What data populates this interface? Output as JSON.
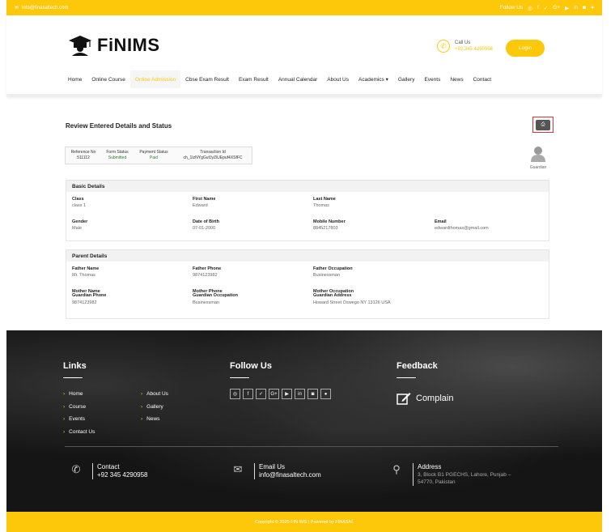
{
  "topbar": {
    "email": "info@finasaltech.com",
    "follow_label": "Follow Us",
    "social_icons": [
      "whatsapp-icon",
      "facebook-icon",
      "twitter-icon",
      "google-plus-icon",
      "youtube-icon",
      "linkedin-icon",
      "instagram-icon",
      "dribbble-icon"
    ]
  },
  "header": {
    "brand": "FiNIMS",
    "call_label": "Call Us",
    "call_number": "+92 345 4290958",
    "login_label": "Login"
  },
  "nav": {
    "items": [
      "Home",
      "Online Course",
      "Online Admission",
      "Cbse Exam Result",
      "Exam Result",
      "Annual Calendar",
      "About Us",
      "Academics ▾",
      "Gallery",
      "Events",
      "News",
      "Contact"
    ],
    "active": "Online Admission"
  },
  "review": {
    "title": "Review Entered Details and Status",
    "status": {
      "reference_label": "Reference No",
      "reference_value": "511112",
      "form_label": "Form Status",
      "form_value": "Submitted",
      "payment_label": "Payment Status",
      "payment_value": "Paid",
      "txn_label": "Transaction Id",
      "txn_value": "ch_1IzNYgGufJyZiUEpuf4XSfFC"
    },
    "guardian_label": "Guardian"
  },
  "basic": {
    "title": "Basic Details",
    "class_k": "Class",
    "class_v": "class 1",
    "first_k": "First Name",
    "first_v": "Edward",
    "last_k": "Last Name",
    "last_v": "Thomas",
    "gender_k": "Gender",
    "gender_v": "Male",
    "dob_k": "Date of Birth",
    "dob_v": "07-01-2000",
    "mobile_k": "Mobile Number",
    "mobile_v": "8845217803",
    "email_k": "Email",
    "email_v": "edwardthomas@gmail.com"
  },
  "parent": {
    "title": "Parent Details",
    "fname_k": "Father Name",
    "fname_v": "Mr. Thomas",
    "fphone_k": "Father Phone",
    "fphone_v": "9874123982",
    "focc_k": "Father Occupation",
    "focc_v": "Businessman",
    "mname_k": "Mother Name",
    "gphone_k": "Guardian Phone",
    "gphone_v": "9874123982",
    "mphone_k": "Mother Phone",
    "gocc_k": "Guardian Occupation",
    "gocc_v": "Businessman",
    "mocc_k": "Mother Occupation",
    "gaddr_k": "Guardian Address",
    "gaddr_v": "Howard Street Oswego NY 13126 USA"
  },
  "footer": {
    "links_title": "Links",
    "links_col1": [
      "Home",
      "Course",
      "Events",
      "Contact Us"
    ],
    "links_col2": [
      "About Us",
      "Gallery",
      "News"
    ],
    "follow_title": "Follow Us",
    "feedback_title": "Feedback",
    "complain_label": "Complain",
    "contact_label": "Contact",
    "contact_value": "+92 345 4290958",
    "email_label": "Email Us",
    "email_value": "info@finasaltech.com",
    "address_label": "Address",
    "address_line1": "3, Block B1 PGECHS, Lahore, Punjab –",
    "address_line2": "54770, Pakistan"
  },
  "copyright": "Copyright © 2025 FIN IMS | Powered by FINASAL",
  "colors": {
    "accent": "#fec80a",
    "status_green": "#2e7d32",
    "print_border": "#dd3333"
  }
}
